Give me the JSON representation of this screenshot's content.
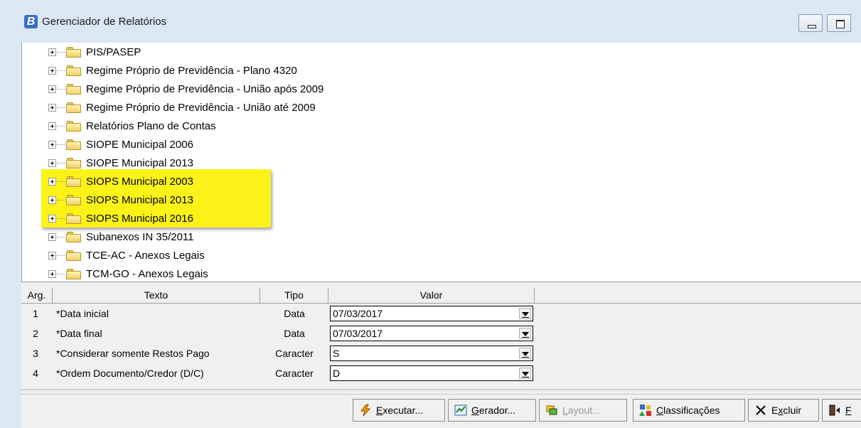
{
  "window": {
    "title": "Gerenciador de Relatórios",
    "icon_letter": "B"
  },
  "tree": {
    "items": [
      {
        "label": "PIS/PASEP"
      },
      {
        "label": "Regime Próprio de Previdência - Plano 4320"
      },
      {
        "label": "Regime Próprio de Previdência - União após 2009"
      },
      {
        "label": "Regime Próprio de Previdência - União até 2009"
      },
      {
        "label": "Relatórios Plano de Contas"
      },
      {
        "label": "SIOPE Municipal 2006"
      },
      {
        "label": "SIOPE Municipal 2013"
      },
      {
        "label": "SIOPS Municipal 2003",
        "highlighted": true
      },
      {
        "label": "SIOPS Municipal 2013",
        "highlighted": true
      },
      {
        "label": "SIOPS Municipal 2016",
        "highlighted": true
      },
      {
        "label": "Subanexos IN 35/2011"
      },
      {
        "label": "TCE-AC - Anexos Legais"
      },
      {
        "label": "TCM-GO - Anexos Legais"
      }
    ],
    "highlight_color": "#fbf317"
  },
  "params": {
    "headers": {
      "arg": "Arg.",
      "texto": "Texto",
      "tipo": "Tipo",
      "valor": "Valor"
    },
    "rows": [
      {
        "arg": "1",
        "texto": "*Data inicial",
        "tipo": "Data",
        "valor": "07/03/2017"
      },
      {
        "arg": "2",
        "texto": "*Data final",
        "tipo": "Data",
        "valor": "07/03/2017"
      },
      {
        "arg": "3",
        "texto": "*Considerar somente Restos Pago",
        "tipo": "Caracter",
        "valor": "S"
      },
      {
        "arg": "4",
        "texto": "*Ordem Documento/Credor (D/C)",
        "tipo": "Caracter",
        "valor": "D"
      }
    ]
  },
  "toolbar": {
    "executar": {
      "hot": "E",
      "rest": "xecutar...",
      "icon": "lightning-icon"
    },
    "gerador": {
      "hot": "G",
      "rest": "erador...",
      "icon": "report-generator-icon"
    },
    "layout": {
      "hot": "L",
      "rest": "ayout...",
      "icon": "layout-icon",
      "disabled": true
    },
    "classificacoes": {
      "hot": "C",
      "rest": "lassificações",
      "icon": "classification-icon"
    },
    "excluir": {
      "pre": "E",
      "hot": "x",
      "rest": "cluir",
      "icon": "close-x-icon"
    },
    "sair": {
      "hot": "F",
      "icon": "exit-door-icon"
    }
  }
}
